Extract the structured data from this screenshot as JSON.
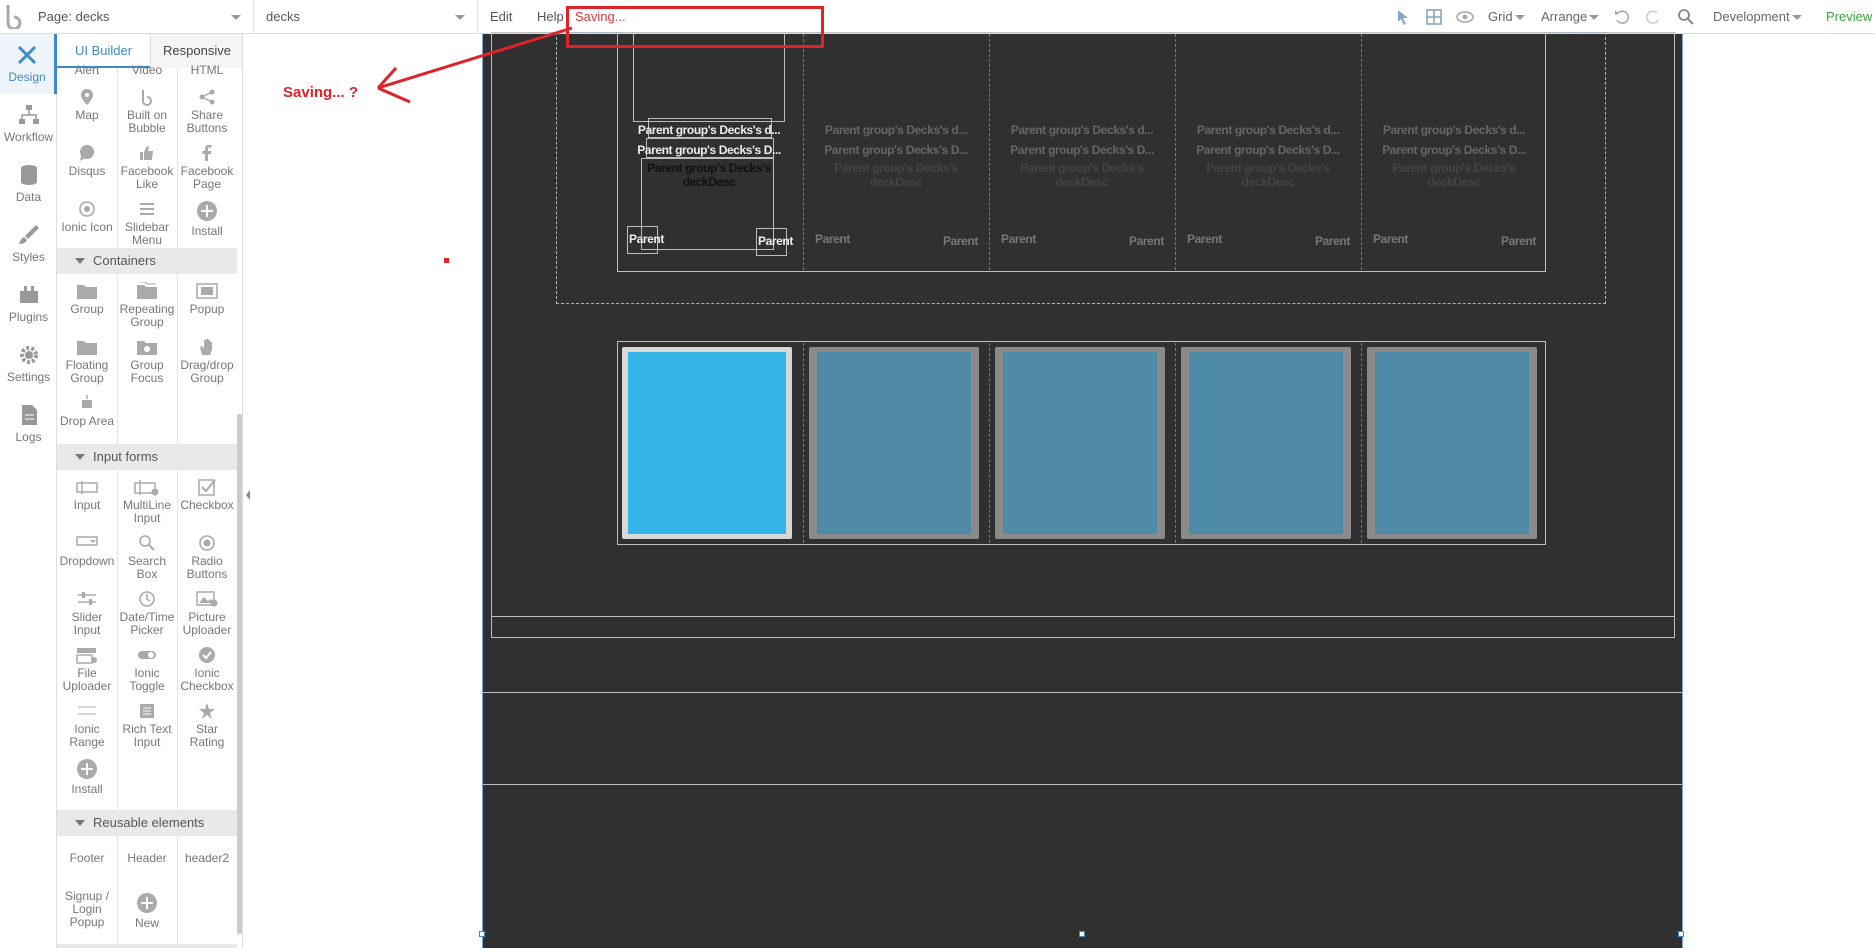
{
  "topbar": {
    "page_select": "Page: decks",
    "element_select": "decks",
    "edit": "Edit",
    "help": "Help",
    "saving": "Saving...",
    "grid": "Grid",
    "arrange": "Arrange",
    "development": "Development",
    "preview": "Preview"
  },
  "leftnav": {
    "items": [
      {
        "label": "Design",
        "icon": "design-icon"
      },
      {
        "label": "Workflow",
        "icon": "workflow-icon"
      },
      {
        "label": "Data",
        "icon": "database-icon"
      },
      {
        "label": "Styles",
        "icon": "brush-icon"
      },
      {
        "label": "Plugins",
        "icon": "plugin-icon"
      },
      {
        "label": "Settings",
        "icon": "gear-icon"
      },
      {
        "label": "Logs",
        "icon": "document-icon"
      }
    ]
  },
  "palette": {
    "tabs": [
      "UI Builder",
      "Responsive"
    ],
    "top_row": [
      "Alert",
      "Video",
      "HTML"
    ],
    "visual": [
      [
        "Map",
        "Built on Bubble",
        "Share Buttons"
      ],
      [
        "Disqus",
        "Facebook Like",
        "Facebook Page"
      ],
      [
        "Ionic Icon",
        "Slidebar Menu",
        "Install"
      ]
    ],
    "containers_title": "Containers",
    "containers": [
      [
        "Group",
        "Repeating Group",
        "Popup"
      ],
      [
        "Floating Group",
        "Group Focus",
        "Drag/drop Group"
      ],
      [
        "Drop Area",
        "",
        ""
      ]
    ],
    "inputs_title": "Input forms",
    "inputs": [
      [
        "Input",
        "MultiLine Input",
        "Checkbox"
      ],
      [
        "Dropdown",
        "Search Box",
        "Radio Buttons"
      ],
      [
        "Slider Input",
        "Date/Time Picker",
        "Picture Uploader"
      ],
      [
        "File Uploader",
        "Ionic Toggle",
        "Ionic Checkbox"
      ],
      [
        "Ionic Range",
        "Rich Text Input",
        "Star Rating"
      ],
      [
        "Install",
        "",
        ""
      ]
    ],
    "reusable_title": "Reusable elements",
    "reusable": [
      [
        "Footer",
        "Header",
        "header2"
      ],
      [
        "Signup / Login Popup",
        "New",
        ""
      ]
    ]
  },
  "canvas": {
    "card_text_a": "Parent group's Decks's d...",
    "card_text_b": "Parent group's Decks's D...",
    "card_text_c": "Parent group's Decks's deckDesc",
    "parent_label": "Parent"
  },
  "annotation": {
    "label": "Saving... ?",
    "color": "#e0232a"
  },
  "colors": {
    "accent": "#3b8bc4",
    "canvas_bg": "#303030",
    "selected_tile": "#34b5e8",
    "tile": "#4f8aa6"
  }
}
